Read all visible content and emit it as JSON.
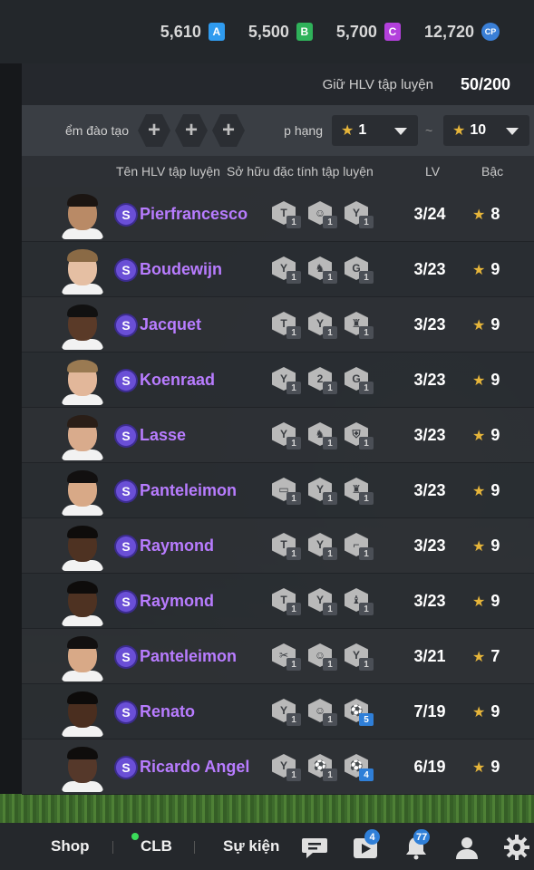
{
  "currencies": [
    {
      "value": "5,610",
      "badge": "A",
      "color": "#2f9bef"
    },
    {
      "value": "5,500",
      "badge": "B",
      "color": "#2fb25a"
    },
    {
      "value": "5,700",
      "badge": "C",
      "color": "#b340dc"
    },
    {
      "value": "12,720",
      "badge": "CP",
      "color": "#3a7fd6"
    }
  ],
  "hold": {
    "label": "Giữ HLV tập luyện",
    "count": "50/200"
  },
  "filter": {
    "training_label": "ểm đào tạo",
    "plus_symbol": "+",
    "rank_label": "p hạng",
    "rank_from": "1",
    "rank_to": "10",
    "separator": "~"
  },
  "columns": {
    "name": "Tên HLV tập luyện",
    "traits": "Sở hữu đặc tính tập luyện",
    "lv": "LV",
    "rank": "Bậc"
  },
  "coaches": [
    {
      "badge": "S",
      "name": "Pierfrancesco",
      "traits": [
        {
          "icon": "T",
          "level": "1"
        },
        {
          "icon": "☺",
          "level": "1"
        },
        {
          "icon": "Y",
          "level": "1"
        }
      ],
      "lv": "3/24",
      "rank": "8",
      "skin": "#b98a66",
      "hair": "#1b1512"
    },
    {
      "badge": "S",
      "name": "Boudewijn",
      "traits": [
        {
          "icon": "Y",
          "level": "1"
        },
        {
          "icon": "♞",
          "level": "1"
        },
        {
          "icon": "G",
          "level": "1"
        }
      ],
      "lv": "3/23",
      "rank": "9",
      "skin": "#e5bfa3",
      "hair": "#8a6a45"
    },
    {
      "badge": "S",
      "name": "Jacquet",
      "traits": [
        {
          "icon": "T",
          "level": "1"
        },
        {
          "icon": "Y",
          "level": "1"
        },
        {
          "icon": "♜",
          "level": "1"
        }
      ],
      "lv": "3/23",
      "rank": "9",
      "skin": "#5a3a28",
      "hair": "#111111"
    },
    {
      "badge": "S",
      "name": "Koenraad",
      "traits": [
        {
          "icon": "Y",
          "level": "1"
        },
        {
          "icon": "2",
          "level": "1"
        },
        {
          "icon": "G",
          "level": "1"
        }
      ],
      "lv": "3/23",
      "rank": "9",
      "skin": "#e2b79a",
      "hair": "#9a7a52"
    },
    {
      "badge": "S",
      "name": "Lasse",
      "traits": [
        {
          "icon": "Y",
          "level": "1"
        },
        {
          "icon": "♞",
          "level": "1"
        },
        {
          "icon": "⛨",
          "level": "1"
        }
      ],
      "lv": "3/23",
      "rank": "9",
      "skin": "#d9ab8c",
      "hair": "#2a1e17"
    },
    {
      "badge": "S",
      "name": "Panteleimon",
      "traits": [
        {
          "icon": "▭",
          "level": "1"
        },
        {
          "icon": "Y",
          "level": "1"
        },
        {
          "icon": "♜",
          "level": "1"
        }
      ],
      "lv": "3/23",
      "rank": "9",
      "skin": "#d8a987",
      "hair": "#121010"
    },
    {
      "badge": "S",
      "name": "Raymond",
      "traits": [
        {
          "icon": "T",
          "level": "1"
        },
        {
          "icon": "Y",
          "level": "1"
        },
        {
          "icon": "⌐",
          "level": "1"
        }
      ],
      "lv": "3/23",
      "rank": "9",
      "skin": "#4e3222",
      "hair": "#0e0c0b"
    },
    {
      "badge": "S",
      "name": "Raymond",
      "traits": [
        {
          "icon": "T",
          "level": "1"
        },
        {
          "icon": "Y",
          "level": "1"
        },
        {
          "icon": "♝",
          "level": "1"
        }
      ],
      "lv": "3/23",
      "rank": "9",
      "skin": "#4e3222",
      "hair": "#0e0c0b"
    },
    {
      "badge": "S",
      "name": "Panteleimon",
      "traits": [
        {
          "icon": "✂",
          "level": "1"
        },
        {
          "icon": "☺",
          "level": "1"
        },
        {
          "icon": "Y",
          "level": "1"
        }
      ],
      "lv": "3/21",
      "rank": "7",
      "skin": "#d8a987",
      "hair": "#121010"
    },
    {
      "badge": "S",
      "name": "Renato",
      "traits": [
        {
          "icon": "Y",
          "level": "1"
        },
        {
          "icon": "☺",
          "level": "1"
        },
        {
          "icon": "⚽",
          "level": "5"
        }
      ],
      "lv": "7/19",
      "rank": "9",
      "skin": "#4a2e1f",
      "hair": "#0d0b0a"
    },
    {
      "badge": "S",
      "name": "Ricardo Angel",
      "traits": [
        {
          "icon": "Y",
          "level": "1"
        },
        {
          "icon": "⚽",
          "level": "1"
        },
        {
          "icon": "⚽",
          "level": "4"
        }
      ],
      "lv": "6/19",
      "rank": "9",
      "skin": "#55382a",
      "hair": "#0f0d0c"
    }
  ],
  "nav": {
    "shop": "Shop",
    "clb": "CLB",
    "events": "Sự kiện",
    "icons": [
      "chat-icon",
      "video-icon",
      "bell-icon",
      "profile-icon",
      "gear-icon"
    ],
    "video_badge": "4",
    "bell_badge": "77"
  }
}
